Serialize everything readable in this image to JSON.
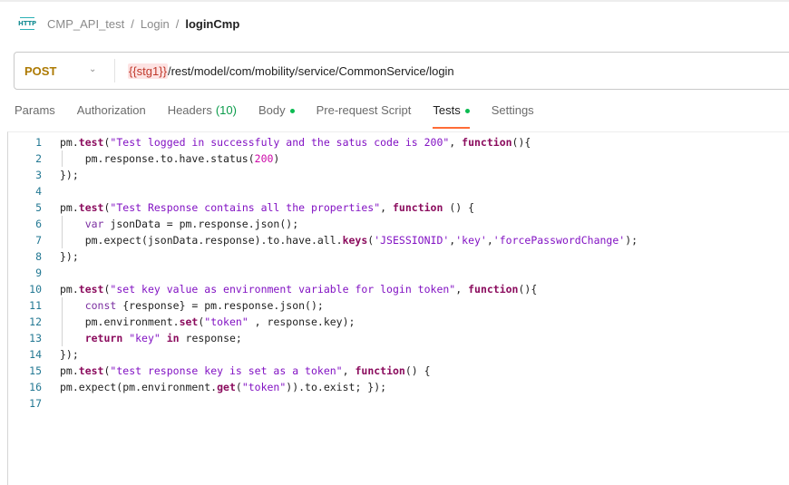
{
  "breadcrumb": {
    "icon": "http-icon",
    "icon_text": "HTTP",
    "items": [
      "CMP_API_test",
      "Login"
    ],
    "separator": "/",
    "current": "loginCmp"
  },
  "request": {
    "method": "POST",
    "url_variable": "{{stg1}}",
    "url_path": "/rest/model/com/mobility/service/CommonService/login"
  },
  "tabs": [
    {
      "label": "Params"
    },
    {
      "label": "Authorization"
    },
    {
      "label": "Headers",
      "count": "(10)"
    },
    {
      "label": "Body",
      "dot": true
    },
    {
      "label": "Pre-request Script"
    },
    {
      "label": "Tests",
      "dot": true,
      "active": true
    },
    {
      "label": "Settings"
    }
  ],
  "colors": {
    "accent_tab_underline": "#ff6c37",
    "method_post": "#ad7a03",
    "status_dot": "#0cbb52",
    "line_number": "#237893"
  },
  "editor": {
    "line_numbers": [
      "1",
      "2",
      "3",
      "4",
      "5",
      "6",
      "7",
      "8",
      "9",
      "10",
      "11",
      "12",
      "13",
      "14",
      "15",
      "16",
      "17"
    ],
    "lines": [
      "pm.test(\"Test logged in successfuly and the satus code is 200\", function(){",
      "    pm.response.to.have.status(200)",
      "});",
      "",
      "pm.test(\"Test Response contains all the properties\", function () {",
      "    var jsonData = pm.response.json();",
      "    pm.expect(jsonData.response).to.have.all.keys('JSESSIONID','key','forcePasswordChange');",
      "});",
      "",
      "pm.test(\"set key value as environment variable for login token\", function(){",
      "    const {response} = pm.response.json();",
      "    pm.environment.set(\"token\" , response.key);",
      "    return \"key\" in response;",
      "});",
      "pm.test(\"test response key is set as a token\", function() {",
      "pm.expect(pm.environment.get(\"token\")).to.exist; });",
      ""
    ]
  }
}
